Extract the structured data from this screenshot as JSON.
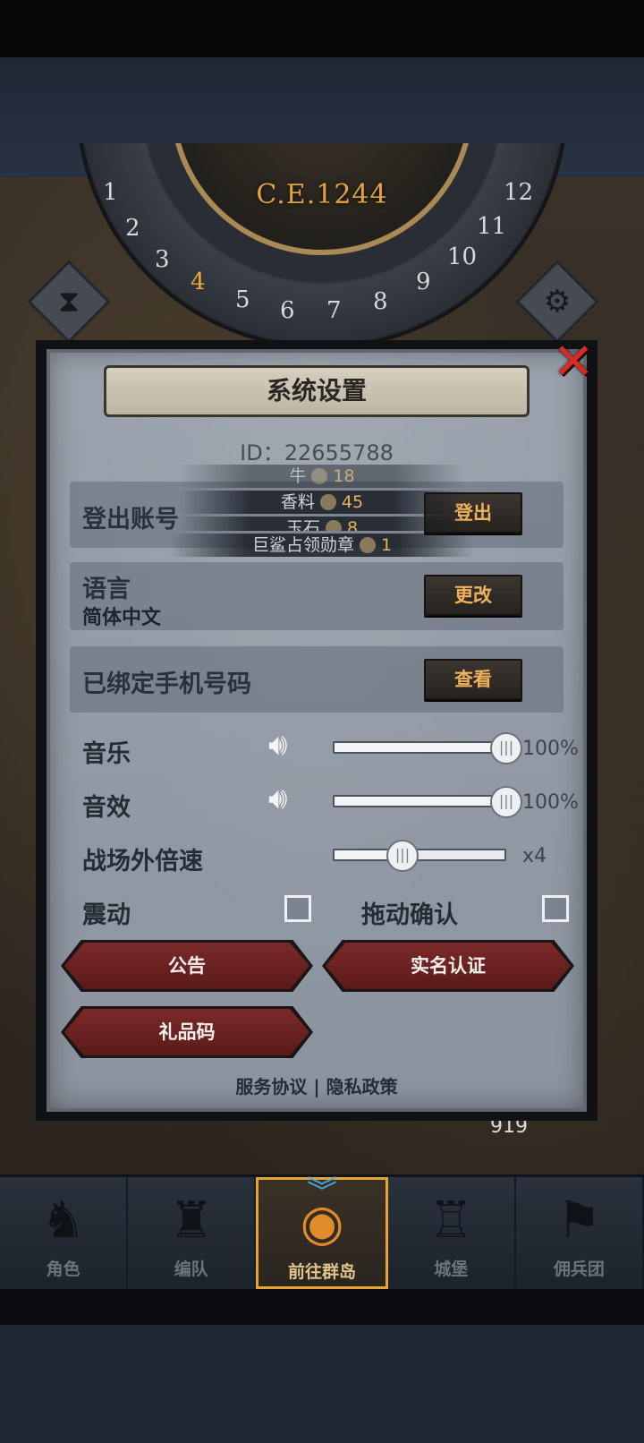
{
  "background": {
    "year": "C.E.1244",
    "dial_numbers": [
      "1",
      "2",
      "3",
      "4",
      "5",
      "6",
      "7",
      "8",
      "9",
      "10",
      "11",
      "12"
    ],
    "active_number": "4",
    "hourglass_icon": "hourglass-icon",
    "settings_icon": "gear-icon",
    "resource_count": "919"
  },
  "settings": {
    "title": "系统设置",
    "id_text": "ID：22655788",
    "logout": {
      "label": "登出账号",
      "button": "登出"
    },
    "language": {
      "label": "语言",
      "value": "简体中文",
      "button": "更改"
    },
    "phone": {
      "label": "已绑定手机号码",
      "button": "查看"
    },
    "music": {
      "label": "音乐",
      "value": "100%",
      "level": 1.0
    },
    "sfx": {
      "label": "音效",
      "value": "100%",
      "level": 1.0
    },
    "speed": {
      "label": "战场外倍速",
      "value": "x4",
      "level": 0.4
    },
    "vibration": {
      "label": "震动",
      "checked": false
    },
    "drag_confirm": {
      "label": "拖动确认",
      "checked": false
    },
    "announcement_button": "公告",
    "realname_button": "实名认证",
    "gift_code_button": "礼品码",
    "service_link": "服务协议",
    "separator": "|",
    "privacy_link": "隐私政策"
  },
  "resource_tooltip": [
    {
      "name": "牛",
      "amount": "18"
    },
    {
      "name": "香料",
      "amount": "45"
    },
    {
      "name": "玉石",
      "amount": "8"
    },
    {
      "name": "巨鲨占领勋章",
      "amount": "1"
    }
  ],
  "bottom_nav": {
    "items": [
      {
        "label": "角色",
        "icon": "knight-icon"
      },
      {
        "label": "编队",
        "icon": "squad-icon"
      },
      {
        "label": "前往群岛",
        "icon": "globe-icon",
        "active": true
      },
      {
        "label": "城堡",
        "icon": "castle-icon"
      },
      {
        "label": "佣兵团",
        "icon": "banner-icon"
      }
    ]
  },
  "colors": {
    "accent": "#e5a530",
    "close": "#d62b27",
    "button_text": "#f0b25a",
    "red_button": "#6a2322"
  }
}
